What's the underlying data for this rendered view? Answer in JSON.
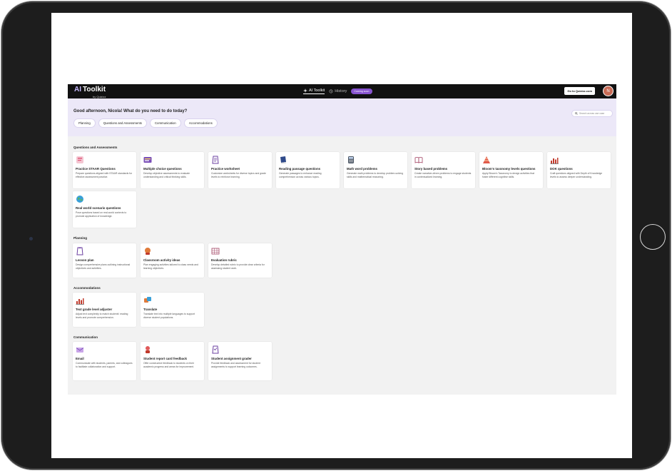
{
  "app": {
    "logo_ai": "AI",
    "logo_toolkit": "Toolkit",
    "logo_by": "by Quizizz",
    "nav": {
      "toolkit": "AI Toolkit",
      "history": "History",
      "coming_soon": "Coming soon"
    },
    "goto_button": "Go to Quizizz.com",
    "avatar_initial": "N"
  },
  "greeting": {
    "title": "Good afternoon, Nicola! What do you need to do today?",
    "chips": [
      "Planning",
      "Questions and Assessments",
      "Communication",
      "Accommodations"
    ],
    "search_placeholder": "Search across use case"
  },
  "sections": {
    "qa": {
      "title": "Questions and Assessments",
      "cards": [
        {
          "title": "Practice STAAR Questions",
          "desc": "Prepare questions aligned with STAAR standards for effective assessment practice.",
          "icon": "staar-icon"
        },
        {
          "title": "Multiple choice questions",
          "desc": "Develop objective assessments to evaluate understanding and critical thinking skills.",
          "icon": "mcq-icon"
        },
        {
          "title": "Practice worksheet",
          "desc": "Customize worksheets for diverse topics and grade levels to reinforce learning.",
          "icon": "worksheet-icon"
        },
        {
          "title": "Reading passage questions",
          "desc": "Generate passages to enhance reading comprehension across various topics.",
          "icon": "book-icon"
        },
        {
          "title": "Math word problems",
          "desc": "Generate math problems to develop problem-solving skills and mathematical reasoning.",
          "icon": "calculator-icon"
        },
        {
          "title": "Story based problems",
          "desc": "Create narrative-driven problems to engage students in contextualized learning.",
          "icon": "open-book-icon"
        },
        {
          "title": "Bloom's taxonomy levels questions",
          "desc": "Apply Bloom's Taxonomy to design activities that foster different cognitive skills.",
          "icon": "pyramid-icon"
        },
        {
          "title": "DOK questions",
          "desc": "Craft questions aligned with Depth of Knowledge levels to assess deeper understanding.",
          "icon": "bar-chart-icon"
        },
        {
          "title": "Real world scenario questions",
          "desc": "Pose questions based on real-world contexts to promote application of knowledge.",
          "icon": "globe-icon"
        }
      ]
    },
    "planning": {
      "title": "Planning",
      "cards": [
        {
          "title": "Lesson plan",
          "desc": "Design comprehensive plans outlining instructional objectives and activities.",
          "icon": "clipboard-icon"
        },
        {
          "title": "Classroom activity ideas",
          "desc": "Plan engaging activities tailored to class needs and learning objectives.",
          "icon": "activity-icon"
        },
        {
          "title": "Evaluation rubric",
          "desc": "Develop detailed rubric to provide clear criteria for assessing student work.",
          "icon": "rubric-icon"
        }
      ]
    },
    "accommodations": {
      "title": "Accommodations",
      "cards": [
        {
          "title": "Text grade level adjuster",
          "desc": "Adjust text complexity to match students' reading levels and promote comprehension.",
          "icon": "bar-chart-icon"
        },
        {
          "title": "Translate",
          "desc": "Translate text into multiple languages to support diverse student populations.",
          "icon": "translate-icon"
        }
      ]
    },
    "communication": {
      "title": "Communication",
      "cards": [
        {
          "title": "Email",
          "desc": "Communicate with students, parents, and colleagues to facilitate collaboration and support.",
          "icon": "email-icon"
        },
        {
          "title": "Student report card feedback",
          "desc": "Offer constructive feedback to students on their academic progress and areas for improvement.",
          "icon": "report-card-icon"
        },
        {
          "title": "Student assignment grader",
          "desc": "Provide feedback and assessment for student assignments to support learning outcomes.",
          "icon": "grader-icon"
        }
      ]
    }
  },
  "colors": {
    "accent": "#8854d0",
    "band": "#ece8f8",
    "bar": "#111111"
  }
}
